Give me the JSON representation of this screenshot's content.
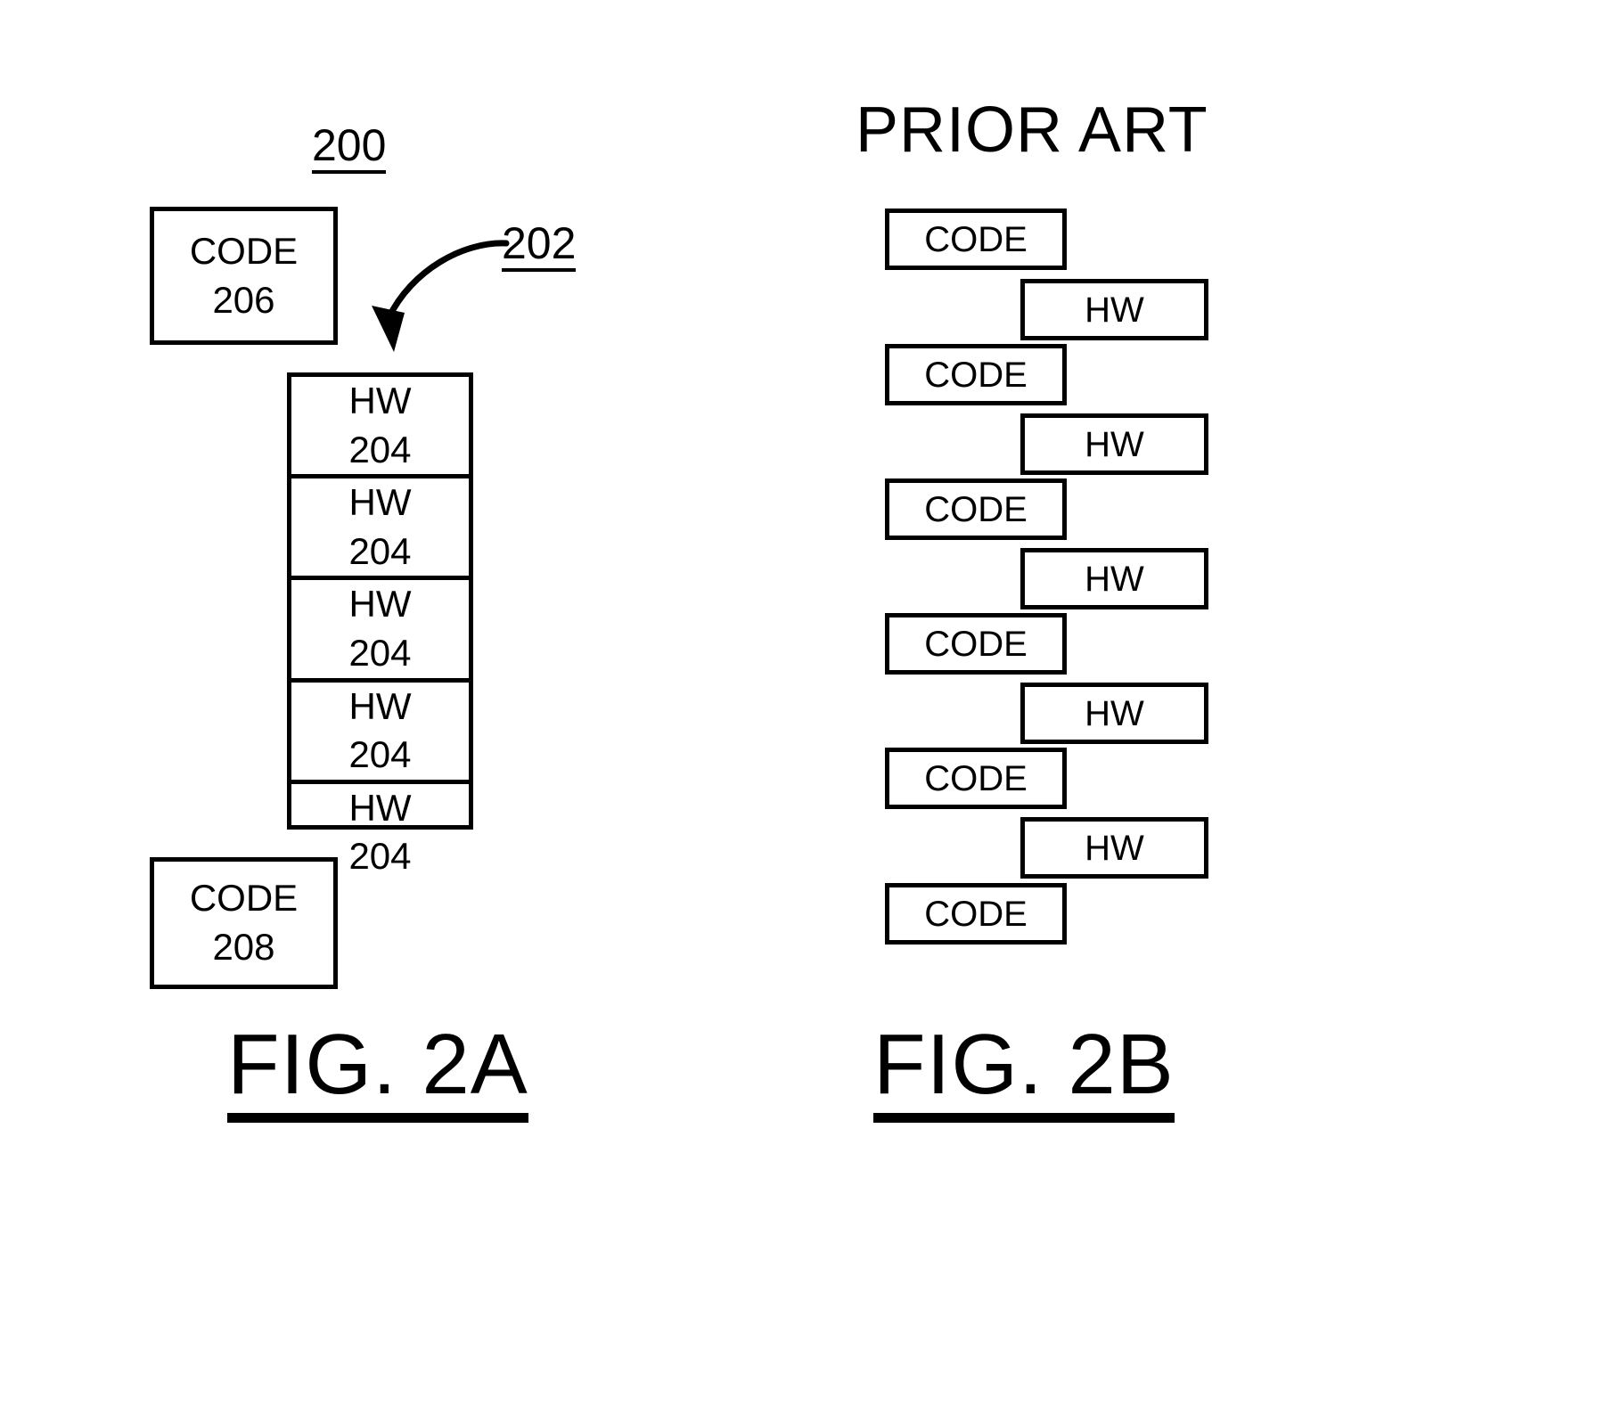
{
  "figures": [
    {
      "id": "fig-2a",
      "caption": "FIG. 2A",
      "ref_number": "200",
      "callout": {
        "label": "202",
        "icon": "curved-arrow-icon"
      },
      "blocks": {
        "code_top": {
          "line1": "CODE",
          "line2": "206"
        },
        "code_bottom": {
          "line1": "CODE",
          "line2": "208"
        },
        "hw_stack": [
          {
            "line1": "HW",
            "line2": "204"
          },
          {
            "line1": "HW",
            "line2": "204"
          },
          {
            "line1": "HW",
            "line2": "204"
          },
          {
            "line1": "HW",
            "line2": "204"
          },
          {
            "line1": "HW",
            "line2": "204"
          }
        ]
      }
    },
    {
      "id": "fig-2b",
      "caption": "FIG. 2B",
      "title": "PRIOR ART",
      "blocks": [
        {
          "kind": "code",
          "label": "CODE"
        },
        {
          "kind": "hw",
          "label": "HW"
        },
        {
          "kind": "code",
          "label": "CODE"
        },
        {
          "kind": "hw",
          "label": "HW"
        },
        {
          "kind": "code",
          "label": "CODE"
        },
        {
          "kind": "hw",
          "label": "HW"
        },
        {
          "kind": "code",
          "label": "CODE"
        },
        {
          "kind": "hw",
          "label": "HW"
        },
        {
          "kind": "code",
          "label": "CODE"
        },
        {
          "kind": "hw",
          "label": "HW"
        },
        {
          "kind": "code",
          "label": "CODE"
        }
      ]
    }
  ],
  "colors": {
    "ink": "#000000",
    "paper": "#ffffff"
  }
}
